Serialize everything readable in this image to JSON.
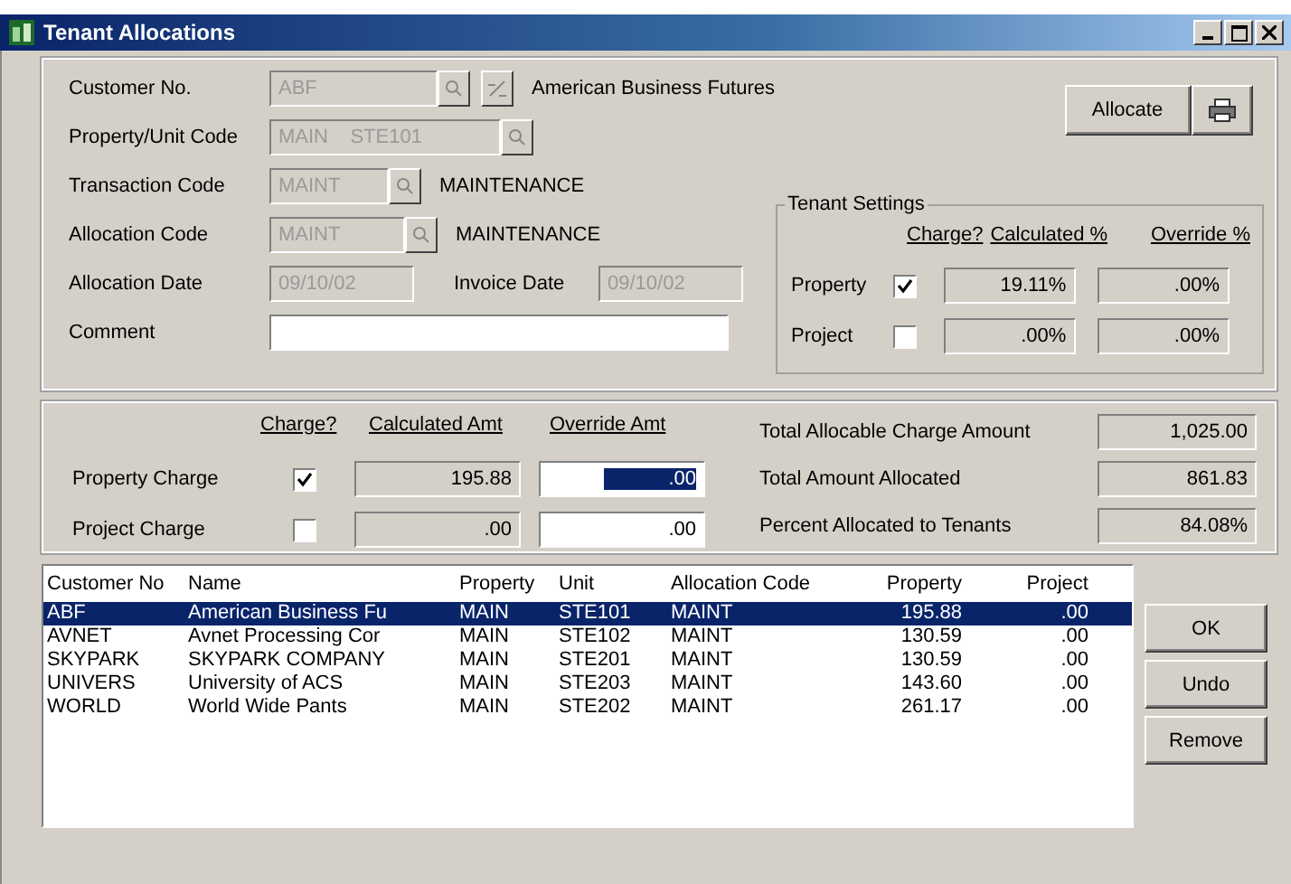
{
  "window": {
    "title": "Tenant Allocations"
  },
  "header_fields": [
    {
      "kind": "customer",
      "label": "Customer No.",
      "value": "ABF",
      "description": "American Business Futures"
    },
    {
      "kind": "lookup",
      "label": "Property/Unit Code",
      "value": "MAIN    STE101"
    },
    {
      "kind": "lookup",
      "label": "Transaction Code",
      "value": "MAINT",
      "description": "MAINTENANCE"
    },
    {
      "kind": "lookup",
      "label": "Allocation Code",
      "value": "MAINT",
      "description": "MAINTENANCE"
    }
  ],
  "allocation_date": {
    "label": "Allocation Date",
    "value": "09/10/02"
  },
  "invoice_date": {
    "label": "Invoice Date",
    "value": "09/10/02"
  },
  "comment": {
    "label": "Comment"
  },
  "allocate_button": "Allocate",
  "tenant_settings": {
    "title": "Tenant Settings",
    "columns": [
      "Charge?",
      "Calculated %",
      "Override %"
    ],
    "rows": [
      {
        "label": "Property",
        "checked": true,
        "calculated": "19.11%",
        "override": ".00%"
      },
      {
        "label": "Project",
        "checked": false,
        "calculated": ".00%",
        "override": ".00%"
      }
    ]
  },
  "charges": {
    "columns": [
      "Charge?",
      "Calculated Amt",
      "Override Amt"
    ],
    "rows": [
      {
        "label": "Property Charge",
        "checked": true,
        "calculated": "195.88",
        "override": ".00",
        "override_selected": true
      },
      {
        "label": "Project Charge",
        "checked": false,
        "calculated": ".00",
        "override": ".00",
        "override_selected": false
      }
    ]
  },
  "totals": [
    {
      "label": "Total Allocable Charge Amount",
      "value": "1,025.00"
    },
    {
      "label": "Total Amount Allocated",
      "value": "861.83"
    },
    {
      "label": "Percent Allocated to Tenants",
      "value": "84.08%"
    }
  ],
  "table": {
    "columns": [
      "Customer No",
      "Name",
      "Property",
      "Unit",
      "Allocation Code",
      "Property",
      "Project"
    ],
    "rows": [
      {
        "selected": true,
        "cells": [
          "ABF",
          "American Business Fu",
          "MAIN",
          "STE101",
          "MAINT",
          "195.88",
          ".00"
        ]
      },
      {
        "selected": false,
        "cells": [
          "AVNET",
          "Avnet Processing Cor",
          "MAIN",
          "STE102",
          "MAINT",
          "130.59",
          ".00"
        ]
      },
      {
        "selected": false,
        "cells": [
          "SKYPARK",
          "SKYPARK COMPANY",
          "MAIN",
          "STE201",
          "MAINT",
          "130.59",
          ".00"
        ]
      },
      {
        "selected": false,
        "cells": [
          "UNIVERS",
          "University of ACS",
          "MAIN",
          "STE203",
          "MAINT",
          "143.60",
          ".00"
        ]
      },
      {
        "selected": false,
        "cells": [
          "WORLD",
          "World Wide Pants",
          "MAIN",
          "STE202",
          "MAINT",
          "261.17",
          ".00"
        ]
      }
    ]
  },
  "buttons": [
    "OK",
    "Undo",
    "Remove"
  ]
}
